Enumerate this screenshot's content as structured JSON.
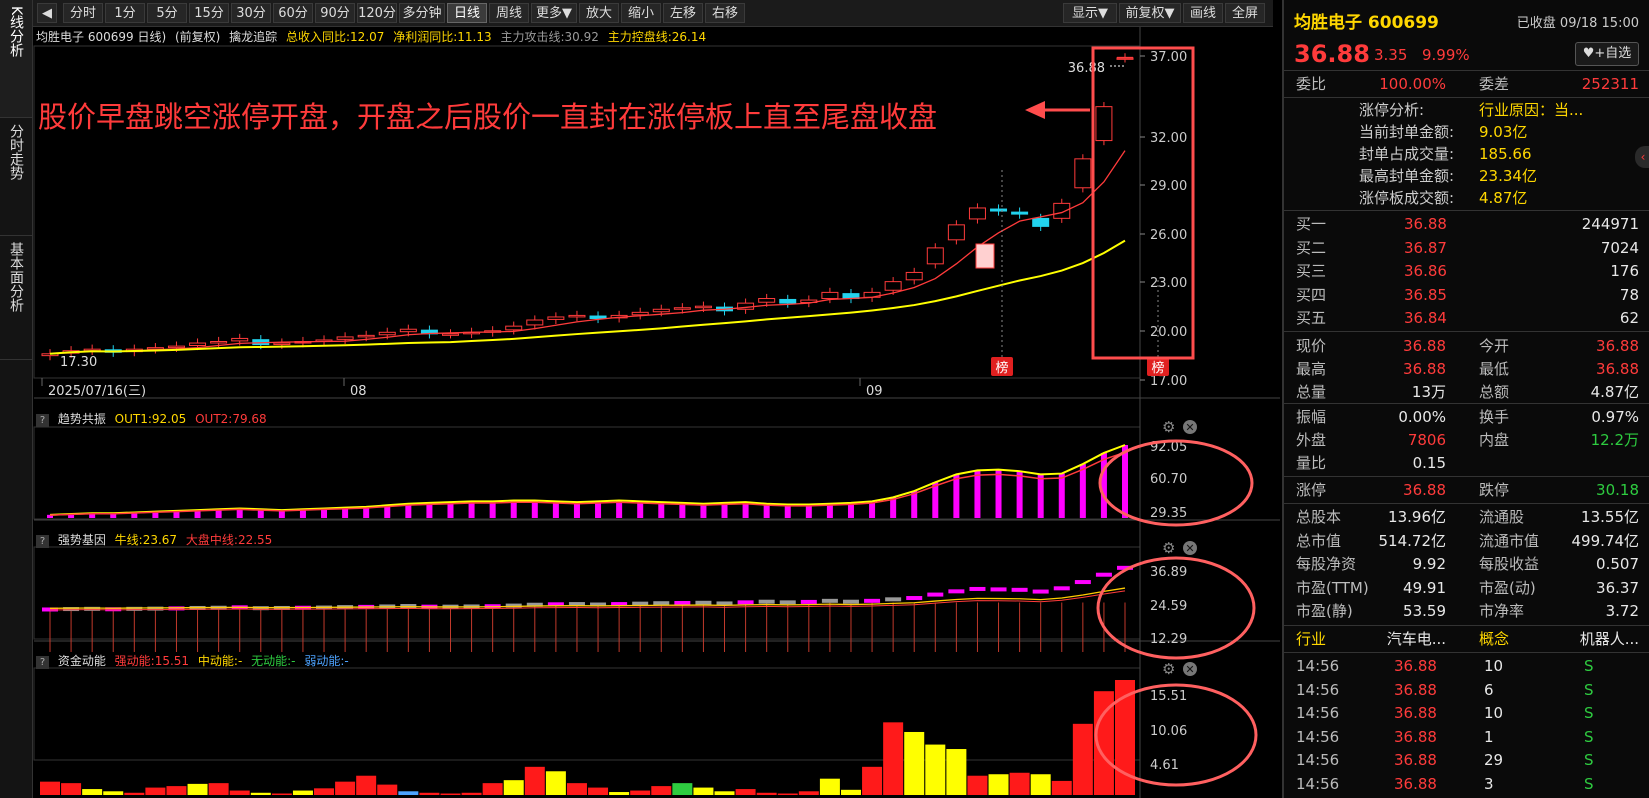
{
  "left_tabs": [
    "K线分析",
    "分时走势",
    "基本面分析"
  ],
  "toolbar": {
    "periods": [
      "分时",
      "1分",
      "5分",
      "15分",
      "30分",
      "60分",
      "90分",
      "120分",
      "多分钟",
      "日线",
      "周线",
      "更多▼",
      "放大",
      "缩小",
      "左移",
      "右移"
    ],
    "active_period": "日线",
    "right_buttons": [
      "显示▼",
      "前复权▼",
      "画线",
      "全屏"
    ]
  },
  "main_info": {
    "title": "均胜电子 600699 日线)",
    "adjust": "(前复权)",
    "indicator": "擒龙追踪",
    "items": [
      {
        "label": "总收入同比:12.07",
        "color": "#ffd700"
      },
      {
        "label": "净利润同比:11.13",
        "color": "#ffd700"
      },
      {
        "label": "主力攻击线:30.92",
        "color": "#9a9a9a"
      },
      {
        "label": "主力控盘线:26.14",
        "color": "#ffd700"
      }
    ]
  },
  "annotation": "股价早盘跳空涨停开盘，开盘之后股价一直封在涨停板上直至尾盘收盘",
  "main_chart": {
    "price_labels": [
      "37.00",
      "32.00",
      "29.00",
      "26.00",
      "23.00",
      "20.00",
      "17.00"
    ],
    "date_labels": [
      "2025/07/16(三)",
      "08",
      "09"
    ],
    "high_label": "36.88",
    "low_label": "17.30",
    "bang_label": "榜"
  },
  "ind1": {
    "name": "趋势共振",
    "out1": "OUT1:92.05",
    "out2": "OUT2:79.68",
    "levels": [
      "92.05",
      "60.70",
      "29.35"
    ]
  },
  "ind2": {
    "name": "强势基因",
    "niu": "牛线:23.67",
    "dapan": "大盘中线:22.55",
    "levels": [
      "36.89",
      "24.59",
      "12.29"
    ]
  },
  "ind3": {
    "name": "资金动能",
    "strong": "强动能:15.51",
    "mid": "中动能:-",
    "none": "无动能:-",
    "weak": "弱动能:-",
    "levels": [
      "15.51",
      "10.06",
      "4.61"
    ]
  },
  "chart_data": {
    "type": "candlestick",
    "title": "均胜电子 600699 日线",
    "ylim": [
      17.0,
      37.0
    ],
    "closes": [
      17.6,
      17.8,
      17.9,
      17.7,
      17.9,
      18.0,
      18.1,
      18.3,
      18.4,
      18.6,
      18.2,
      18.3,
      18.4,
      18.5,
      18.7,
      18.8,
      19.0,
      19.2,
      18.9,
      18.9,
      19.0,
      19.1,
      19.4,
      19.8,
      20.0,
      20.1,
      19.9,
      20.1,
      20.3,
      20.5,
      20.6,
      20.7,
      20.4,
      20.9,
      21.2,
      20.9,
      21.1,
      21.6,
      21.2,
      21.6,
      22.3,
      22.9,
      24.5,
      26.0,
      27.1,
      26.9,
      26.7,
      25.9,
      27.4,
      30.3,
      33.7,
      36.88
    ],
    "ind1_values": [
      4,
      5,
      6,
      6,
      7,
      8,
      9,
      10,
      11,
      12,
      11,
      10,
      11,
      12,
      13,
      14,
      16,
      18,
      19,
      20,
      21,
      21,
      22,
      22,
      21,
      20,
      21,
      22,
      21,
      20,
      19,
      18,
      19,
      20,
      18,
      17,
      17,
      18,
      19,
      21,
      26,
      34,
      45,
      55,
      60,
      61,
      59,
      55,
      56,
      68,
      82,
      92
    ],
    "ind3_values": [
      1.8,
      1.6,
      0.8,
      0.5,
      0.3,
      1.0,
      1.2,
      1.5,
      1.6,
      0.6,
      0.3,
      0.2,
      0.6,
      0.9,
      1.8,
      2.6,
      1.4,
      0.5,
      0.3,
      0.2,
      0.3,
      1.6,
      2.0,
      3.8,
      3.2,
      1.6,
      1.0,
      0.4,
      0.6,
      1.2,
      1.6,
      1.0,
      0.5,
      0.8,
      0.3,
      0.2,
      0.5,
      2.2,
      0.7,
      3.8,
      9.8,
      8.5,
      6.8,
      6.2,
      2.6,
      2.8,
      3.0,
      2.8,
      1.9,
      9.6,
      14.0,
      15.51
    ]
  },
  "right_panel": {
    "name": "均胜电子 600699",
    "status": "已收盘 09/18 15:00",
    "price": "36.88",
    "change": "3.35",
    "pct": "9.99%",
    "add_btn": "+自选",
    "weibi_label": "委比",
    "weibi": "100.00%",
    "weicha_label": "委差",
    "weicha": "252311",
    "zt_analysis": [
      {
        "label": "涨停分析:",
        "value": "行业原因：当..."
      },
      {
        "label": "当前封单金额:",
        "value": "9.03亿"
      },
      {
        "label": "封单占成交量:",
        "value": "185.66"
      },
      {
        "label": "最高封单金额:",
        "value": "23.34亿"
      },
      {
        "label": "涨停板成交额:",
        "value": "4.87亿"
      }
    ],
    "bids": [
      {
        "label": "买一",
        "price": "36.88",
        "vol": "244971"
      },
      {
        "label": "买二",
        "price": "36.87",
        "vol": "7024"
      },
      {
        "label": "买三",
        "price": "36.86",
        "vol": "176"
      },
      {
        "label": "买四",
        "price": "36.85",
        "vol": "78"
      },
      {
        "label": "买五",
        "price": "36.84",
        "vol": "62"
      }
    ],
    "stats1": [
      {
        "l1": "现价",
        "v1": "36.88",
        "c1": "red",
        "l2": "今开",
        "v2": "36.88",
        "c2": "red"
      },
      {
        "l1": "最高",
        "v1": "36.88",
        "c1": "red",
        "l2": "最低",
        "v2": "36.88",
        "c2": "red"
      },
      {
        "l1": "总量",
        "v1": "13万",
        "c1": "white",
        "l2": "总额",
        "v2": "4.87亿",
        "c2": "white"
      }
    ],
    "stats2": [
      {
        "l1": "振幅",
        "v1": "0.00%",
        "c1": "white",
        "l2": "换手",
        "v2": "0.97%",
        "c2": "white"
      },
      {
        "l1": "外盘",
        "v1": "7806",
        "c1": "red",
        "l2": "内盘",
        "v2": "12.2万",
        "c2": "green"
      },
      {
        "l1": "量比",
        "v1": "0.15",
        "c1": "white",
        "l2": "",
        "v2": "",
        "c2": "white"
      }
    ],
    "limit": {
      "l1": "涨停",
      "v1": "36.88",
      "l2": "跌停",
      "v2": "30.18"
    },
    "fund": [
      {
        "l1": "总股本",
        "v1": "13.96亿",
        "l2": "流通股",
        "v2": "13.55亿"
      },
      {
        "l1": "总市值",
        "v1": "514.72亿",
        "l2": "流通市值",
        "v2": "499.74亿"
      },
      {
        "l1": "每股净资",
        "v1": "9.92",
        "l2": "每股收益",
        "v2": "0.507"
      },
      {
        "l1": "市盈(TTM)",
        "v1": "49.91",
        "l2": "市盈(动)",
        "v2": "36.37"
      },
      {
        "l1": "市盈(静)",
        "v1": "53.59",
        "l2": "市净率",
        "v2": "3.72"
      }
    ],
    "industry": {
      "l1": "行业",
      "v1": "汽车电...",
      "l2": "概念",
      "v2": "机器人..."
    },
    "ticks": [
      {
        "time": "14:56",
        "price": "36.88",
        "vol": "10",
        "side": "S"
      },
      {
        "time": "14:56",
        "price": "36.88",
        "vol": "6",
        "side": "S"
      },
      {
        "time": "14:56",
        "price": "36.88",
        "vol": "10",
        "side": "S"
      },
      {
        "time": "14:56",
        "price": "36.88",
        "vol": "1",
        "side": "S"
      },
      {
        "time": "14:56",
        "price": "36.88",
        "vol": "29",
        "side": "S"
      },
      {
        "time": "14:56",
        "price": "36.88",
        "vol": "3",
        "side": "S"
      }
    ]
  }
}
